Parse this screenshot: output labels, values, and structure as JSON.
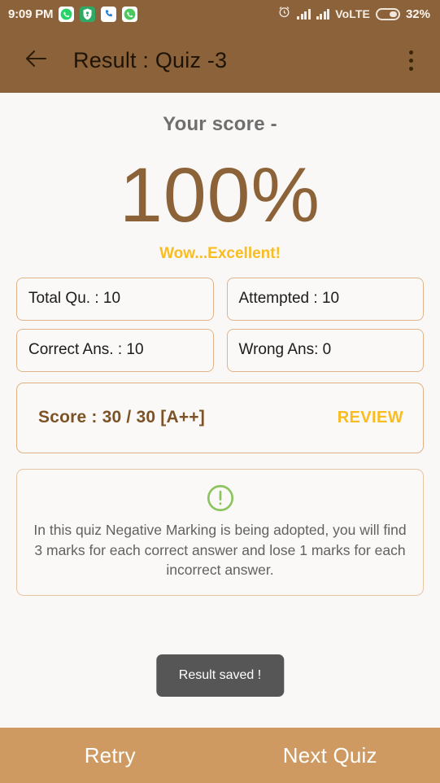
{
  "status_bar": {
    "clock": "9:09 PM",
    "app_icons": [
      {
        "name": "whatsapp-icon"
      },
      {
        "name": "location-shield-icon"
      },
      {
        "name": "phone-icon"
      },
      {
        "name": "whatsapp-business-icon"
      }
    ],
    "alarm_icon": "alarm-clock-icon",
    "signal_1": "signal-bars-icon",
    "signal_2": "signal-bars-icon",
    "network": "VoLTE",
    "battery_icon": "battery-icon",
    "battery_percent": "32%"
  },
  "app_bar": {
    "back_icon": "back-arrow-icon",
    "title": "Result : Quiz -3",
    "menu_icon": "overflow-menu-icon"
  },
  "result": {
    "score_label": "Your score -",
    "score_percent": "100%",
    "praise": "Wow...Excellent!",
    "stats": [
      "Total Qu. : 10",
      "Attempted  : 10",
      "Correct Ans. : 10",
      "Wrong Ans: 0"
    ],
    "score_line": "Score : 30 / 30 [A++]",
    "review_label": "REVIEW",
    "note_icon": "exclamation-circle-icon",
    "note_text": "In this quiz Negative Marking is being adopted, you will find 3 marks for each correct answer and lose 1 marks for each incorrect answer."
  },
  "toast": {
    "message": "Result saved !"
  },
  "bottom_bar": {
    "retry_label": "Retry",
    "next_label": "Next Quiz"
  },
  "colors": {
    "header_brown": "#8b6239",
    "bottom_tan": "#ce9a62",
    "accent_gold": "#f9bc21",
    "score_brown": "#8c6239",
    "note_green": "#8cc45f",
    "page_bg": "#faf8f6"
  }
}
